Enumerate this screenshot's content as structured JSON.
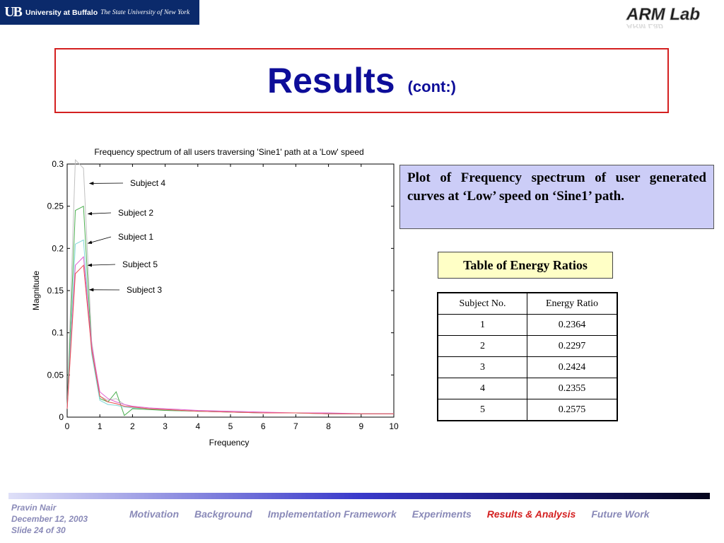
{
  "header": {
    "ub_mark": "UB",
    "university_name": "University at Buffalo",
    "university_sub": "The State University of New York",
    "lab_logo": "ARM Lab"
  },
  "title": {
    "main": "Results",
    "sub": "(cont:)"
  },
  "description": "Plot of Frequency spectrum of user generated curves at ‘Low’ speed on ‘Sine1’ path.",
  "energy_title": "Table of Energy Ratios",
  "table": {
    "headers": [
      "Subject No.",
      "Energy Ratio"
    ],
    "rows": [
      [
        "1",
        "0.2364"
      ],
      [
        "2",
        "0.2297"
      ],
      [
        "3",
        "0.2424"
      ],
      [
        "4",
        "0.2355"
      ],
      [
        "5",
        "0.2575"
      ]
    ]
  },
  "footer": {
    "author": "Pravin Nair",
    "date": "December 12, 2003",
    "slide": "Slide 24 of 30",
    "nav": [
      "Motivation",
      "Background",
      "Implementation Framework",
      "Experiments",
      "Results & Analysis",
      "Future Work"
    ],
    "active_nav": "Results & Analysis"
  },
  "chart_data": {
    "type": "line",
    "title": "Frequency spectrum of all users traversing 'Sine1' path at a 'Low' speed",
    "xlabel": "Frequency",
    "ylabel": "Magnitude",
    "xlim": [
      0,
      10
    ],
    "ylim": [
      0,
      0.3
    ],
    "xticks": [
      "0",
      "1",
      "2",
      "3",
      "4",
      "5",
      "6",
      "7",
      "8",
      "9",
      "10"
    ],
    "yticks": [
      "0",
      "0.05",
      "0.1",
      "0.15",
      "0.2",
      "0.25",
      "0.3"
    ],
    "grid": false,
    "series": [
      {
        "name": "Subject 4",
        "color": "#c0c0c0",
        "x": [
          0,
          0.25,
          0.5,
          0.75,
          1.0,
          1.25,
          1.5,
          1.75,
          2.0,
          2.5,
          3,
          4,
          5,
          6,
          7,
          8,
          9,
          10
        ],
        "y": [
          0.01,
          0.305,
          0.295,
          0.09,
          0.025,
          0.02,
          0.022,
          0.015,
          0.012,
          0.01,
          0.008,
          0.007,
          0.006,
          0.005,
          0.005,
          0.004,
          0.004,
          0.004
        ]
      },
      {
        "name": "Subject 2",
        "color": "#4caf50",
        "x": [
          0,
          0.25,
          0.5,
          0.75,
          1.0,
          1.25,
          1.5,
          1.75,
          2.0,
          2.5,
          3,
          4,
          5,
          6,
          7,
          8,
          9,
          10
        ],
        "y": [
          0.01,
          0.245,
          0.25,
          0.08,
          0.022,
          0.018,
          0.03,
          0.002,
          0.01,
          0.009,
          0.008,
          0.007,
          0.006,
          0.005,
          0.005,
          0.004,
          0.004,
          0.004
        ]
      },
      {
        "name": "Subject 1",
        "color": "#7fd7d7",
        "x": [
          0,
          0.25,
          0.5,
          0.75,
          1.0,
          1.25,
          1.5,
          1.75,
          2.0,
          2.5,
          3,
          4,
          5,
          6,
          7,
          8,
          9,
          10
        ],
        "y": [
          0.01,
          0.205,
          0.21,
          0.075,
          0.02,
          0.015,
          0.014,
          0.012,
          0.011,
          0.01,
          0.009,
          0.007,
          0.006,
          0.005,
          0.005,
          0.004,
          0.004,
          0.004
        ]
      },
      {
        "name": "Subject 5",
        "color": "#e060d0",
        "x": [
          0,
          0.25,
          0.5,
          0.75,
          1.0,
          1.25,
          1.5,
          1.75,
          2.0,
          2.5,
          3,
          4,
          5,
          6,
          7,
          8,
          9,
          10
        ],
        "y": [
          0.01,
          0.18,
          0.19,
          0.085,
          0.03,
          0.022,
          0.018,
          0.015,
          0.013,
          0.011,
          0.01,
          0.008,
          0.007,
          0.006,
          0.005,
          0.005,
          0.004,
          0.004
        ]
      },
      {
        "name": "Subject 3",
        "color": "#e85050",
        "x": [
          0,
          0.25,
          0.5,
          0.75,
          1.0,
          1.25,
          1.5,
          1.75,
          2.0,
          2.5,
          3,
          4,
          5,
          6,
          7,
          8,
          9,
          10
        ],
        "y": [
          0.01,
          0.17,
          0.18,
          0.08,
          0.025,
          0.018,
          0.016,
          0.013,
          0.012,
          0.01,
          0.009,
          0.007,
          0.006,
          0.005,
          0.005,
          0.004,
          0.004,
          0.004
        ]
      }
    ],
    "annotations": [
      {
        "label": "Subject 4",
        "point": [
          0.6,
          0.277
        ]
      },
      {
        "label": "Subject 2",
        "point": [
          0.55,
          0.241
        ]
      },
      {
        "label": "Subject 1",
        "point": [
          0.55,
          0.206
        ]
      },
      {
        "label": "Subject 5",
        "point": [
          0.55,
          0.18
        ]
      },
      {
        "label": "Subject 3",
        "point": [
          0.6,
          0.151
        ]
      }
    ]
  }
}
